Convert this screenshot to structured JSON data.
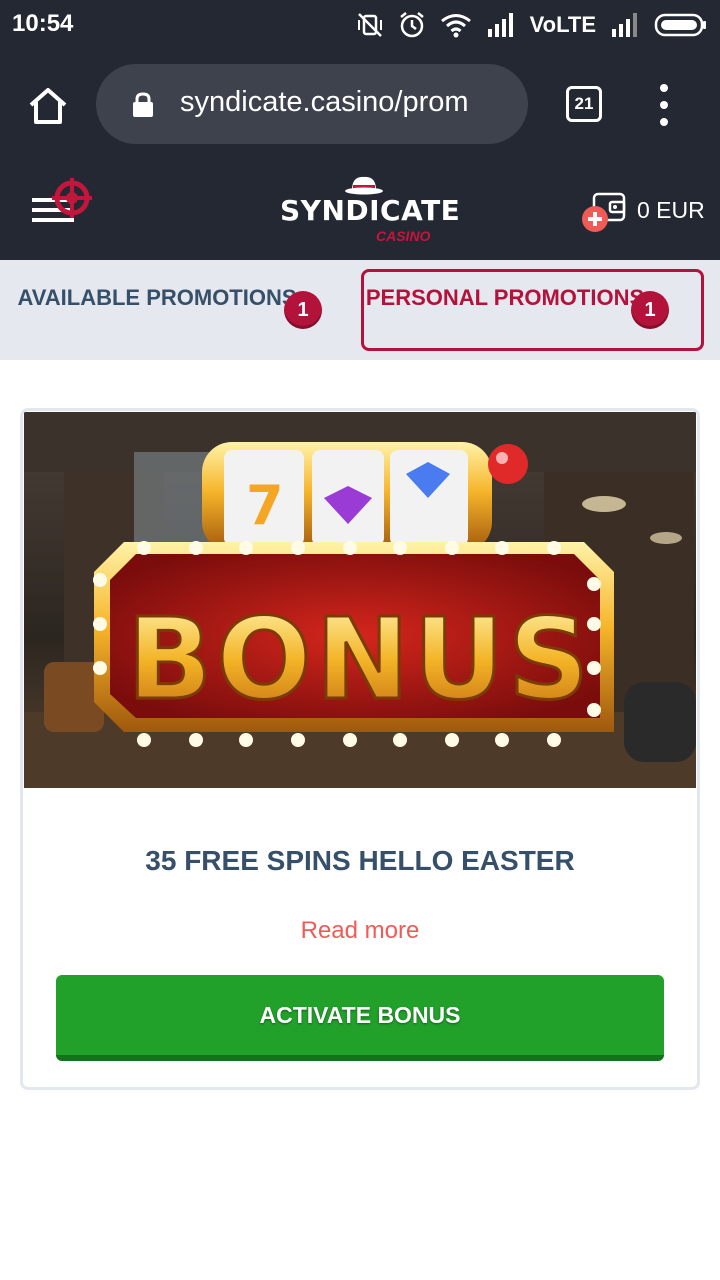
{
  "status_bar": {
    "time": "10:54",
    "network": "VoLTE",
    "icons": [
      "mute-vibrate-icon",
      "alarm-icon",
      "wifi-icon",
      "signal-icon",
      "signal-icon-2",
      "battery-icon"
    ]
  },
  "browser": {
    "url": "syndicate.casino/prom",
    "tab_count": "21",
    "icons": [
      "home-icon",
      "lock-icon",
      "tabs-icon",
      "overflow-menu-icon"
    ]
  },
  "site_header": {
    "logo_main": "SYNDICATE",
    "logo_sub": "CASINO",
    "balance": "0 EUR",
    "icons": [
      "burger-menu-icon",
      "crosshair-icon",
      "wallet-icon",
      "plus-icon"
    ]
  },
  "tabs": [
    {
      "label": "AVAILABLE PROMOTIONS",
      "badge": "1",
      "active": false
    },
    {
      "label": "PERSONAL PROMOTIONS",
      "badge": "1",
      "active": true
    }
  ],
  "promo": {
    "image_text": "BONUS",
    "title": "35 FREE SPINS HELLO EASTER",
    "read_more": "Read more",
    "button": "ACTIVATE BONUS"
  },
  "colors": {
    "header_bg": "#232833",
    "accent_red": "#b3123b",
    "tab_bg": "#e5e9ef",
    "title_text": "#37506a",
    "link": "#ef5b56",
    "button_green": "#21a12a"
  }
}
